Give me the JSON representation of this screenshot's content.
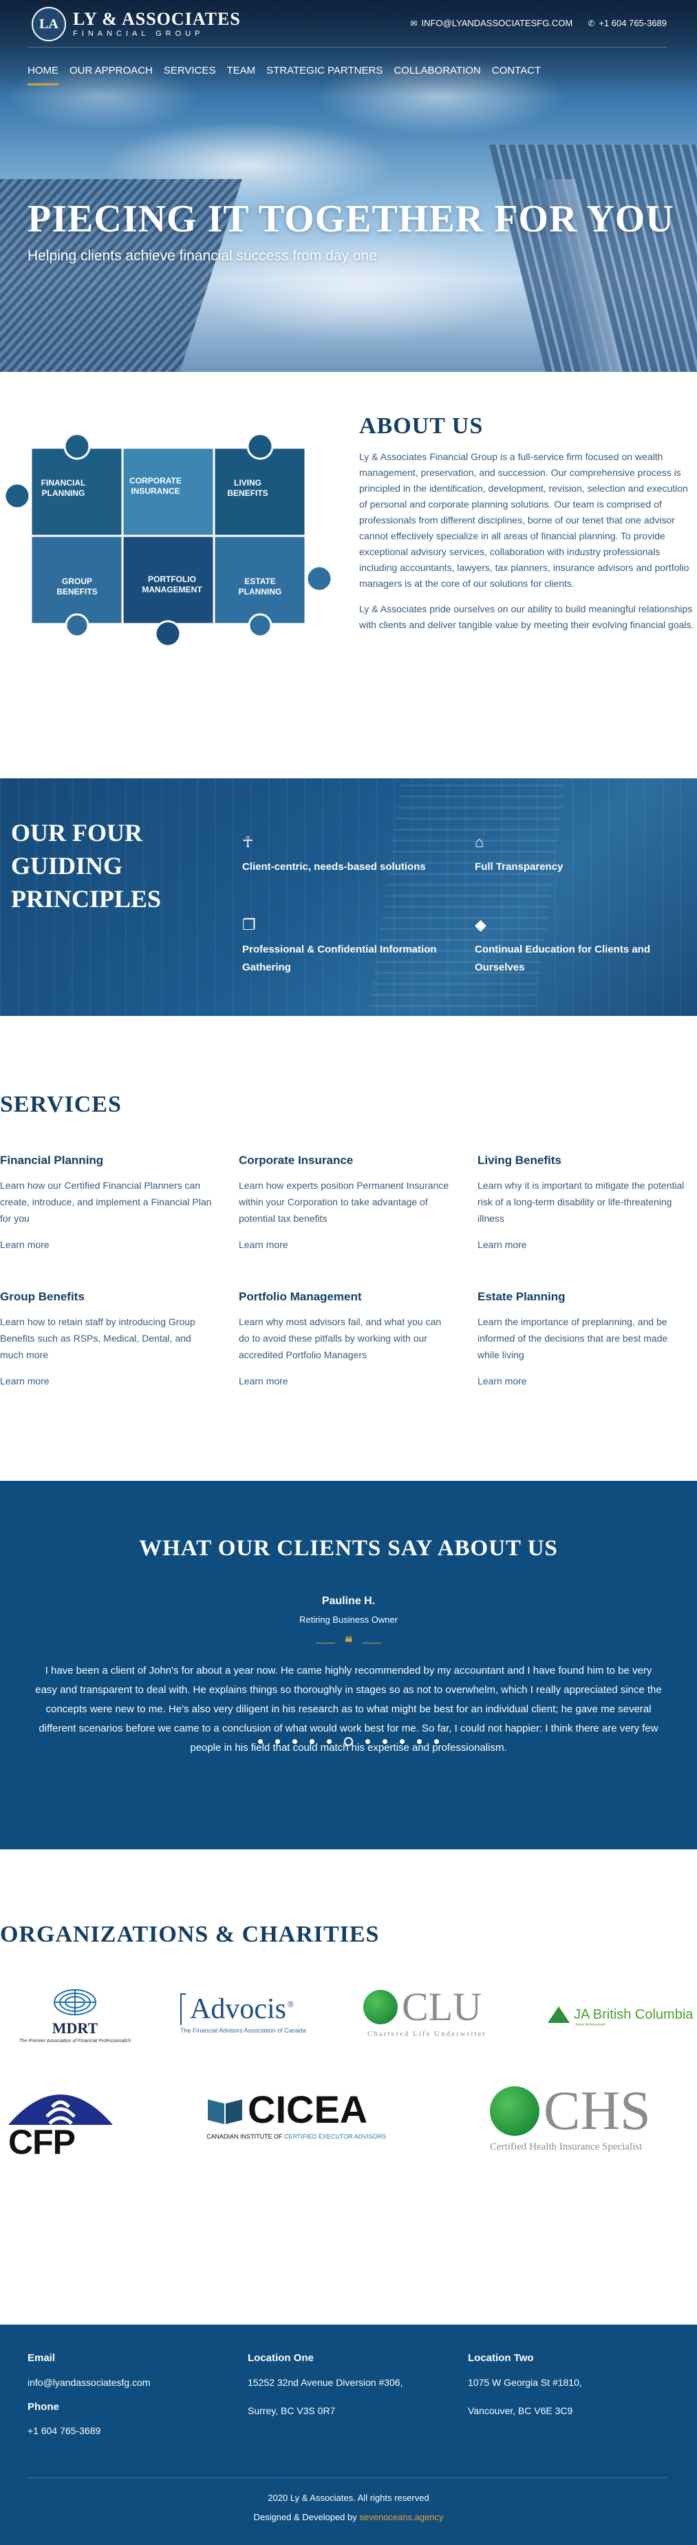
{
  "brand": {
    "initials": "LA",
    "name": "LY & ASSOCIATES",
    "sub": "FINANCIAL GROUP"
  },
  "top_contact": {
    "email": "INFO@LYANDASSOCIATESFG.COM",
    "phone": "+1 604 765-3689"
  },
  "nav": [
    "HOME",
    "OUR APPROACH",
    "SERVICES",
    "TEAM",
    "STRATEGIC PARTNERS",
    "COLLABORATION",
    "CONTACT"
  ],
  "hero": {
    "title": "PIECING IT TOGETHER FOR YOU",
    "subtitle": "Helping clients achieve financial success from day one"
  },
  "puzzle_pieces": [
    "FINANCIAL PLANNING",
    "CORPORATE INSURANCE",
    "LIVING BENEFITS",
    "GROUP BENEFITS",
    "PORTFOLIO MANAGEMENT",
    "ESTATE PLANNING"
  ],
  "about": {
    "title": "ABOUT US",
    "p1": "Ly & Associates Financial Group is a full-service firm focused on wealth management, preservation, and succession. Our comprehensive process is principled in the identification, development, revision, selection and execution of personal and corporate planning solutions. Our team is comprised of professionals from different disciplines, borne of our tenet that one advisor cannot effectively specialize in all areas of financial planning. To provide exceptional advisory services, collaboration with industry professionals including accountants, lawyers, tax planners, insurance advisors and portfolio managers is at the core of our solutions for clients.",
    "p2": "Ly & Associates pride ourselves on our ability to build meaningful relationships with clients and deliver tangible value by meeting their evolving financial goals."
  },
  "principles": {
    "title": "OUR FOUR GUIDING PRINCIPLES",
    "items": [
      {
        "icon": "person-icon",
        "label": "Client-centric, needs-based solutions"
      },
      {
        "icon": "bank-icon",
        "label": "Full Transparency"
      },
      {
        "icon": "copy-icon",
        "label": "Professional & Confidential Information Gathering"
      },
      {
        "icon": "graduation-cap-icon",
        "label": "Continual Education for Clients and Ourselves"
      }
    ]
  },
  "services": {
    "title": "SERVICES",
    "learn_more": "Learn more",
    "items": [
      {
        "title": "Financial Planning",
        "desc": "Learn how our Certified Financial Planners can create, introduce, and implement a Financial Plan for you"
      },
      {
        "title": "Corporate Insurance",
        "desc": "Learn how experts position Permanent Insurance within your Corporation to take advantage of potential tax benefits"
      },
      {
        "title": "Living Benefits",
        "desc": "Learn why it is important to mitigate the potential risk of a long-term disability or life-threatening illness"
      },
      {
        "title": "Group Benefits",
        "desc": "Learn how to retain staff by introducing Group Benefits such as RSPs, Medical, Dental, and much more"
      },
      {
        "title": "Portfolio Management",
        "desc": "Learn why most advisors fail, and what you can do to avoid these pitfalls by working with our accredited Portfolio Managers"
      },
      {
        "title": "Estate Planning",
        "desc": "Learn the importance of preplanning, and be informed of the decisions that are best made while living"
      }
    ]
  },
  "testimonial": {
    "title": "WHAT OUR CLIENTS SAY ABOUT US",
    "name": "Pauline H.",
    "role": "Retiring Business Owner",
    "quote_mark": "❝",
    "text": "I have been a client of John's for about a year now. He came highly recommended by my accountant and I have found him to be very easy and transparent to deal with. He explains things so thoroughly in stages so as not to overwhelm, which I really appreciated since the concepts were new to me. He's also very diligent in his research as to what might be best for an individual client; he gave me several different scenarios before we came to a conclusion of what would work best for me. So far, I could not happier: I think there are very few people in his field that could match his expertise and professionalism.",
    "dots_total": 11,
    "dot_active_index": 5
  },
  "orgs": {
    "title": "ORGANIZATIONS & CHARITIES",
    "mdrt": {
      "name": "MDRT",
      "tag": "The Premier Association of Financial Professionals®"
    },
    "advocis": {
      "name": "Advocis",
      "tag": "The Financial Advisors Association of Canada"
    },
    "clu": {
      "name": "CLU",
      "tag": "Chartered Life Underwriter"
    },
    "ja": {
      "name": "JA British Columbia",
      "tag": "Junior Achievement"
    },
    "cfp": {
      "name": "CFP"
    },
    "cicea": {
      "name": "CICEA",
      "tag_a": "CANADIAN INSTITUTE OF",
      "tag_b": "CERTIFIED EXECUTOR ADVISORS"
    },
    "chs": {
      "name": "CHS",
      "tag": "Certified Health Insurance Specialist"
    }
  },
  "footer": {
    "email_label": "Email",
    "email": "info@lyandassociatesfg.com",
    "phone_label": "Phone",
    "phone": "+1 604 765-3689",
    "loc1_label": "Location One",
    "loc1_line1": "15252 32nd Avenue Diversion #306,",
    "loc1_line2": "Surrey, BC V3S 0R7",
    "loc2_label": "Location Two",
    "loc2_line1": "1075 W Georgia St #1810,",
    "loc2_line2": "Vancouver, BC V6E 3C9",
    "copyright": "2020 Ly & Associates. All rights reserved",
    "credit_prefix": "Designed & Developed by",
    "credit_agency": "sevenoceans.agency"
  },
  "colors": {
    "navy": "#0e4d7d",
    "gold": "#d5a23a",
    "heading": "#143e63"
  }
}
